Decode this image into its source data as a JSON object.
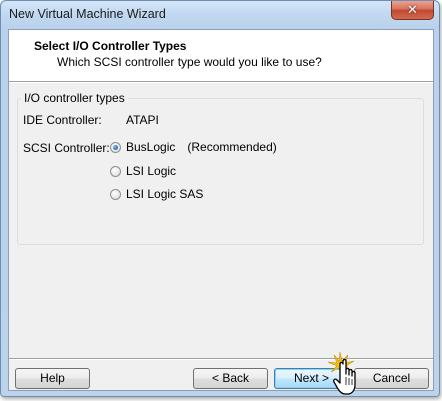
{
  "window": {
    "title": "New Virtual Machine Wizard",
    "close_glyph": "✕"
  },
  "header": {
    "title": "Select I/O Controller Types",
    "subtitle": "Which SCSI controller type would you like to use?"
  },
  "group": {
    "label": "I/O controller types",
    "ide_label": "IDE Controller:",
    "ide_value": "ATAPI",
    "scsi_label": "SCSI Controller:",
    "options": [
      {
        "label": "BusLogic",
        "checked": true,
        "note": "(Recommended)"
      },
      {
        "label": "LSI Logic",
        "checked": false
      },
      {
        "label": "LSI Logic SAS",
        "checked": false
      }
    ]
  },
  "buttons": {
    "help": "Help",
    "back": "< Back",
    "next": "Next >",
    "cancel": "Cancel"
  },
  "icons": {
    "close": "close-icon",
    "cursor": "hand-pointer-icon",
    "click_burst": "click-burst-icon"
  },
  "colors": {
    "accent": "#3c7fb1",
    "close_button": "#c04a32",
    "radio_selected": "#1b5ea8",
    "click_burst": "#f2c21b"
  }
}
